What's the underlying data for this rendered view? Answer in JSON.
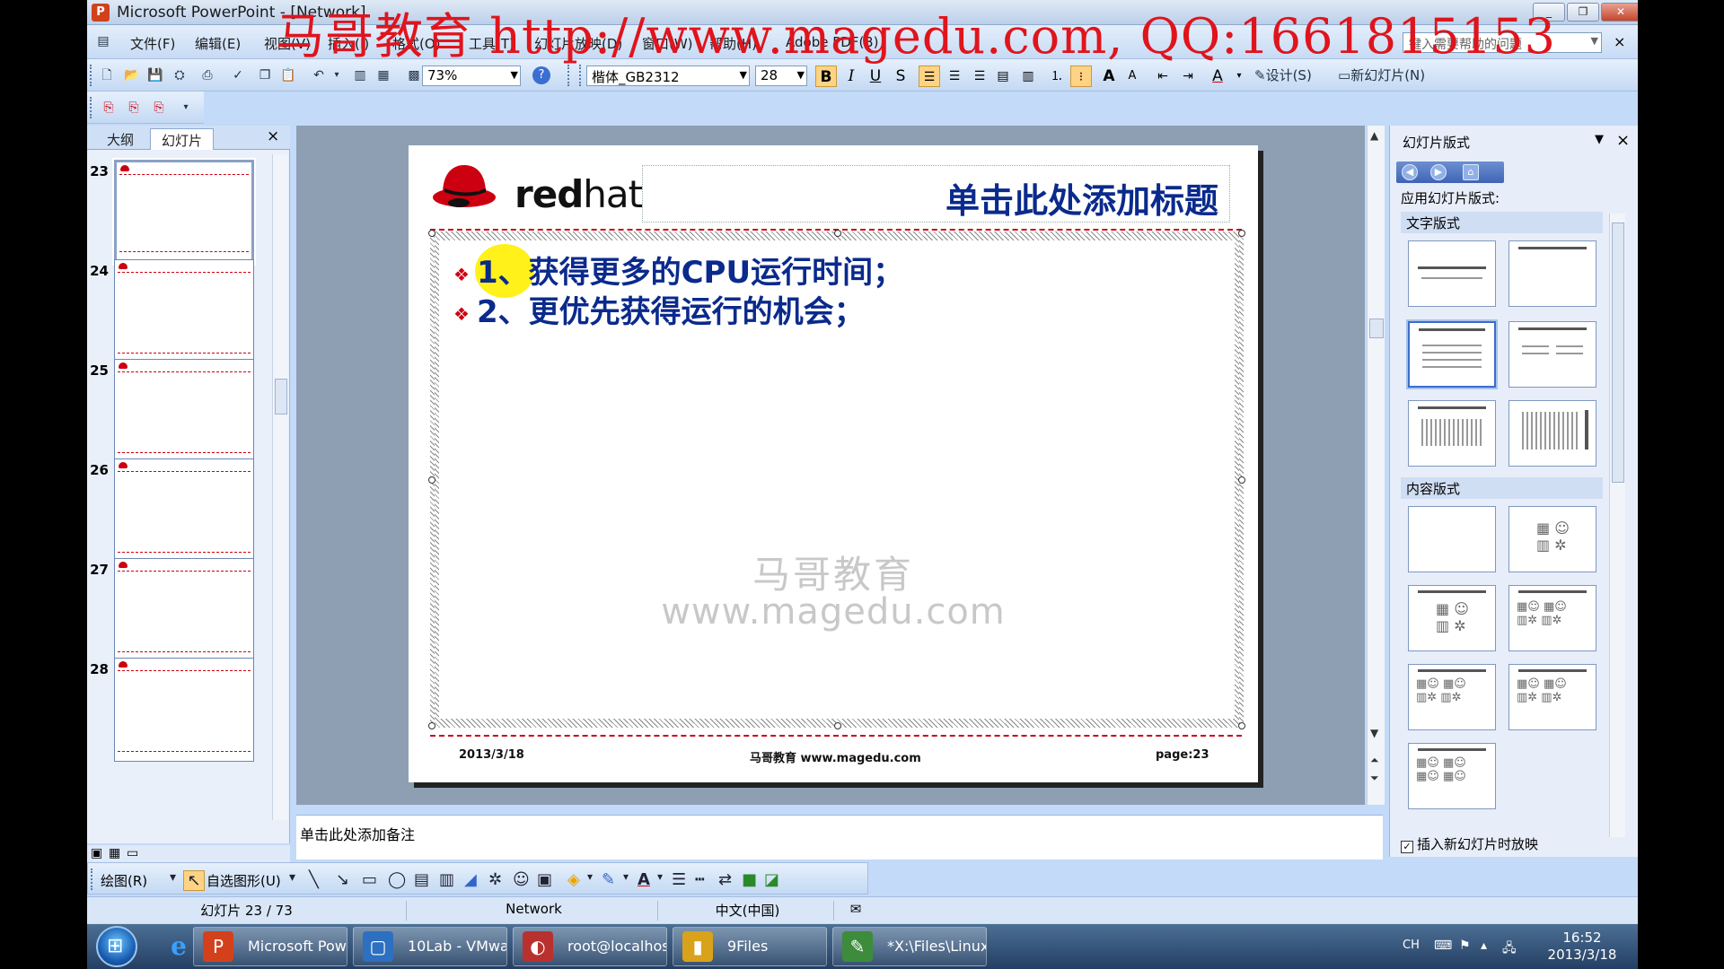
{
  "window": {
    "title": "Microsoft PowerPoint - [Network]",
    "app_icon": "powerpoint-icon",
    "controls": [
      "_",
      "❐",
      "✕"
    ]
  },
  "overlay_watermark": "马哥教育 http://www.magedu.com, QQ:1661815153",
  "menu": {
    "items": [
      "文件(F)",
      "编辑(E)",
      "视图(V)",
      "插入(I)",
      "格式(O)",
      "工具(T)",
      "幻灯片放映(D)",
      "窗口(W)",
      "帮助(H)",
      "Adobe PDF(B)"
    ],
    "help_placeholder": "键入需要帮助的问题",
    "close": "×"
  },
  "toolbar": {
    "zoom": "73%",
    "font": "楷体_GB2312",
    "size": "28",
    "bold": "B",
    "italic": "I",
    "underline": "U",
    "shadow": "S",
    "design_label": "设计(S)",
    "new_slide_label": "新幻灯片(N)",
    "font_grow": "A",
    "font_shrink": "A"
  },
  "left_pane": {
    "tabs": [
      "大纲",
      "幻灯片"
    ],
    "close": "×",
    "slides": [
      {
        "number": "23",
        "selected": true
      },
      {
        "number": "24",
        "selected": false
      },
      {
        "number": "25",
        "selected": false
      },
      {
        "number": "26",
        "selected": false
      },
      {
        "number": "27",
        "selected": false
      },
      {
        "number": "28",
        "selected": false
      }
    ]
  },
  "slide": {
    "logo_text_bold": "red",
    "logo_text_light": "hat",
    "title": "单击此处添加标题",
    "bullets": [
      "1、获得更多的CPU运行时间；",
      "2、更优先获得运行的机会；"
    ],
    "watermark_line1": "马哥教育",
    "watermark_line2": "www.magedu.com",
    "footer_date": "2013/3/18",
    "footer_center": "马哥教育 www.magedu.com",
    "footer_page": "page:23"
  },
  "notes": {
    "placeholder": "单击此处添加备注"
  },
  "task_pane": {
    "title": "幻灯片版式",
    "apply_label": "应用幻灯片版式:",
    "text_layouts_label": "文字版式",
    "content_layouts_label": "内容版式",
    "show_on_insert": "插入新幻灯片时放映",
    "checked_mark": "✓"
  },
  "drawbar": {
    "draw_label": "绘图(R)",
    "autoshape_label": "自选图形(U)"
  },
  "status": {
    "slide_counter": "幻灯片 23 / 73",
    "design_name": "Network",
    "language": "中文(中国)"
  },
  "taskbar": {
    "buttons": [
      {
        "label": "Microsoft Powe...",
        "icon": "powerpoint-icon"
      },
      {
        "label": "10Lab - VMwar...",
        "icon": "vmware-icon"
      },
      {
        "label": "root@localhost:...",
        "icon": "terminal-icon"
      },
      {
        "label": "9Files",
        "icon": "folder-icon"
      },
      {
        "label": "*X:\\Files\\Linux A...",
        "icon": "editor-icon"
      }
    ],
    "language": "CH",
    "time": "16:52",
    "date": "2013/3/18"
  },
  "colors": {
    "watermark_red": "#e0141c",
    "title_blue": "#0a2a8c",
    "accent_red": "#cc0011",
    "pane_blue": "#c3daf9"
  }
}
